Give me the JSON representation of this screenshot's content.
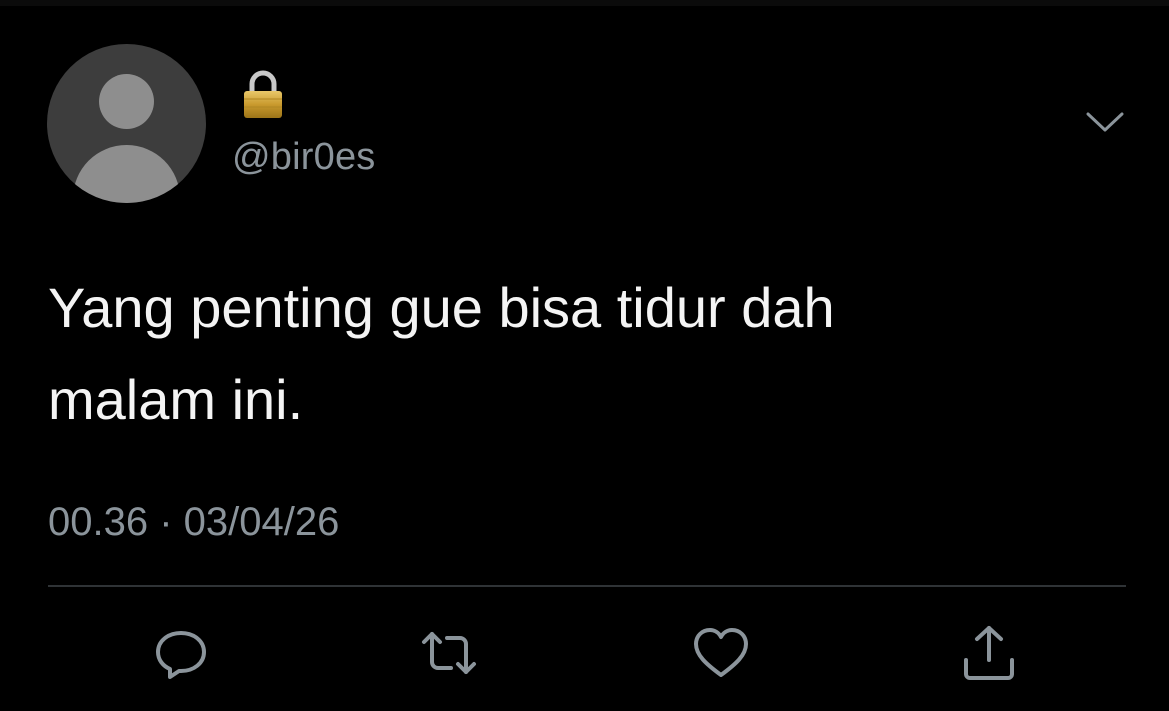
{
  "profile": {
    "avatar_icon": "default-avatar-icon",
    "lock_icon": "lock-icon",
    "handle": "@bir0es"
  },
  "tweet": {
    "text_line1": "Yang penting gue bisa tidur dah",
    "text_line2": "malam ini.",
    "timestamp": "00.36 · 03/04/26"
  },
  "actions": {
    "more_icon": "chevron-down-icon",
    "reply_icon": "reply-icon",
    "retweet_icon": "retweet-icon",
    "like_icon": "heart-icon",
    "share_icon": "share-icon"
  },
  "colors": {
    "background": "#000000",
    "text": "#f4f4f4",
    "muted": "#8b949b",
    "avatar_bg": "#3d3d3d",
    "avatar_fg": "#8e8e8e",
    "divider": "#2f3336"
  }
}
